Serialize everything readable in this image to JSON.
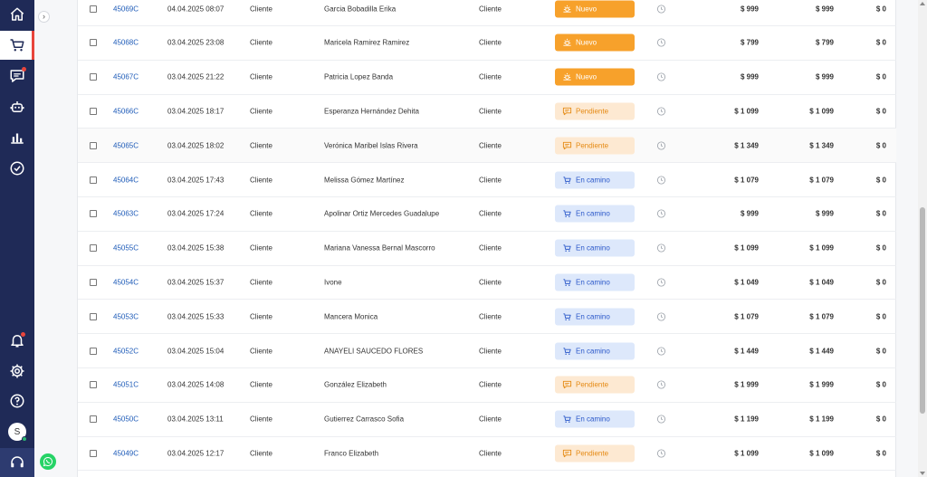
{
  "sidebar": {
    "items": [
      {
        "icon": "home-icon"
      },
      {
        "icon": "cart-icon"
      },
      {
        "icon": "chat-icon"
      },
      {
        "icon": "bot-icon"
      },
      {
        "icon": "chart-icon"
      },
      {
        "icon": "check-circle-icon"
      }
    ],
    "bottom": [
      {
        "icon": "bell-icon"
      },
      {
        "icon": "gear-icon"
      },
      {
        "icon": "help-icon"
      }
    ],
    "avatar_initial": "S"
  },
  "colors": {
    "sidebar_bg": "#1f2a57",
    "accent_red": "#e8453c",
    "status_nuevo": "#f7a12b",
    "status_pendiente": "#fde9d2",
    "status_en_camino": "#dde8fb",
    "link_blue": "#1e5bb8"
  },
  "orders": [
    {
      "id": "45069C",
      "date": "04.04.2025 08:07",
      "type": "Cliente",
      "name": "Garcia Bobadilla Erika",
      "channel": "Cliente",
      "status": "Nuevo",
      "status_kind": "new",
      "amount1": "$ 999",
      "amount2": "$ 999",
      "amount3": "$ 0"
    },
    {
      "id": "45068C",
      "date": "03.04.2025 23:08",
      "type": "Cliente",
      "name": "Maricela Ramirez Ramirez",
      "channel": "Cliente",
      "status": "Nuevo",
      "status_kind": "new",
      "amount1": "$ 799",
      "amount2": "$ 799",
      "amount3": "$ 0"
    },
    {
      "id": "45067C",
      "date": "03.04.2025 21:22",
      "type": "Cliente",
      "name": "Patricia Lopez Banda",
      "channel": "Cliente",
      "status": "Nuevo",
      "status_kind": "new",
      "amount1": "$ 999",
      "amount2": "$ 999",
      "amount3": "$ 0"
    },
    {
      "id": "45066C",
      "date": "03.04.2025 18:17",
      "type": "Cliente",
      "name": "Esperanza Hernández Dehita",
      "channel": "Cliente",
      "status": "Pendiente",
      "status_kind": "pend",
      "amount1": "$ 1 099",
      "amount2": "$ 1 099",
      "amount3": "$ 0"
    },
    {
      "id": "45065C",
      "date": "03.04.2025 18:02",
      "type": "Cliente",
      "name": "Verónica Maribel Islas Rivera",
      "channel": "Cliente",
      "status": "Pendiente",
      "status_kind": "pend",
      "amount1": "$ 1 349",
      "amount2": "$ 1 349",
      "amount3": "$ 0"
    },
    {
      "id": "45064C",
      "date": "03.04.2025 17:43",
      "type": "Cliente",
      "name": "Melissa Gómez Martínez",
      "channel": "Cliente",
      "status": "En camino",
      "status_kind": "road",
      "amount1": "$ 1 079",
      "amount2": "$ 1 079",
      "amount3": "$ 0"
    },
    {
      "id": "45063C",
      "date": "03.04.2025 17:24",
      "type": "Cliente",
      "name": "Apolinar Ortiz Mercedes Guadalupe",
      "channel": "Cliente",
      "status": "En camino",
      "status_kind": "road",
      "amount1": "$ 999",
      "amount2": "$ 999",
      "amount3": "$ 0"
    },
    {
      "id": "45055C",
      "date": "03.04.2025 15:38",
      "type": "Cliente",
      "name": "Mariana Vanessa Bernal Mascorro",
      "channel": "Cliente",
      "status": "En camino",
      "status_kind": "road",
      "amount1": "$ 1 099",
      "amount2": "$ 1 099",
      "amount3": "$ 0"
    },
    {
      "id": "45054C",
      "date": "03.04.2025 15:37",
      "type": "Cliente",
      "name": "Ivone",
      "channel": "Cliente",
      "status": "En camino",
      "status_kind": "road",
      "amount1": "$ 1 049",
      "amount2": "$ 1 049",
      "amount3": "$ 0"
    },
    {
      "id": "45053C",
      "date": "03.04.2025 15:33",
      "type": "Cliente",
      "name": "Mancera Monica",
      "channel": "Cliente",
      "status": "En camino",
      "status_kind": "road",
      "amount1": "$ 1 079",
      "amount2": "$ 1 079",
      "amount3": "$ 0"
    },
    {
      "id": "45052C",
      "date": "03.04.2025 15:04",
      "type": "Cliente",
      "name": "ANAYELI SAUCEDO FLORES",
      "channel": "Cliente",
      "status": "En camino",
      "status_kind": "road",
      "amount1": "$ 1 449",
      "amount2": "$ 1 449",
      "amount3": "$ 0"
    },
    {
      "id": "45051C",
      "date": "03.04.2025 14:08",
      "type": "Cliente",
      "name": "González Elizabeth",
      "channel": "Cliente",
      "status": "Pendiente",
      "status_kind": "pend",
      "amount1": "$ 1 999",
      "amount2": "$ 1 999",
      "amount3": "$ 0"
    },
    {
      "id": "45050C",
      "date": "03.04.2025 13:11",
      "type": "Cliente",
      "name": "Gutierrez Carrasco Sofia",
      "channel": "Cliente",
      "status": "En camino",
      "status_kind": "road",
      "amount1": "$ 1 199",
      "amount2": "$ 1 199",
      "amount3": "$ 0"
    },
    {
      "id": "45049C",
      "date": "03.04.2025 12:17",
      "type": "Cliente",
      "name": "Franco Elizabeth",
      "channel": "Cliente",
      "status": "Pendiente",
      "status_kind": "pend",
      "amount1": "$ 1 099",
      "amount2": "$ 1 099",
      "amount3": "$ 0"
    }
  ]
}
